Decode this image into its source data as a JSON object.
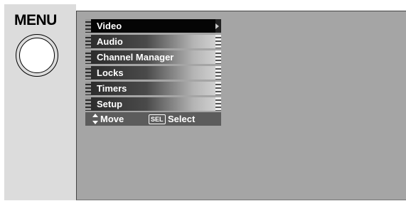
{
  "remote": {
    "menu_label": "MENU"
  },
  "osd_menu": {
    "items": [
      {
        "label": "Video",
        "selected": true
      },
      {
        "label": "Audio",
        "selected": false
      },
      {
        "label": "Channel Manager",
        "selected": false
      },
      {
        "label": "Locks",
        "selected": false
      },
      {
        "label": "Timers",
        "selected": false
      },
      {
        "label": "Setup",
        "selected": false
      }
    ],
    "hint": {
      "move_label": "Move",
      "sel_key_label": "SEL",
      "select_label": "Select"
    }
  },
  "colors": {
    "screen_background": "#a5a5a5",
    "selected_row": "#050505",
    "hint_bar": "#5c5c5c",
    "left_panel": "#dcdcdc"
  },
  "icons": [
    "arrow-right-icon",
    "up-down-arrows-icon",
    "menu-round-button"
  ]
}
